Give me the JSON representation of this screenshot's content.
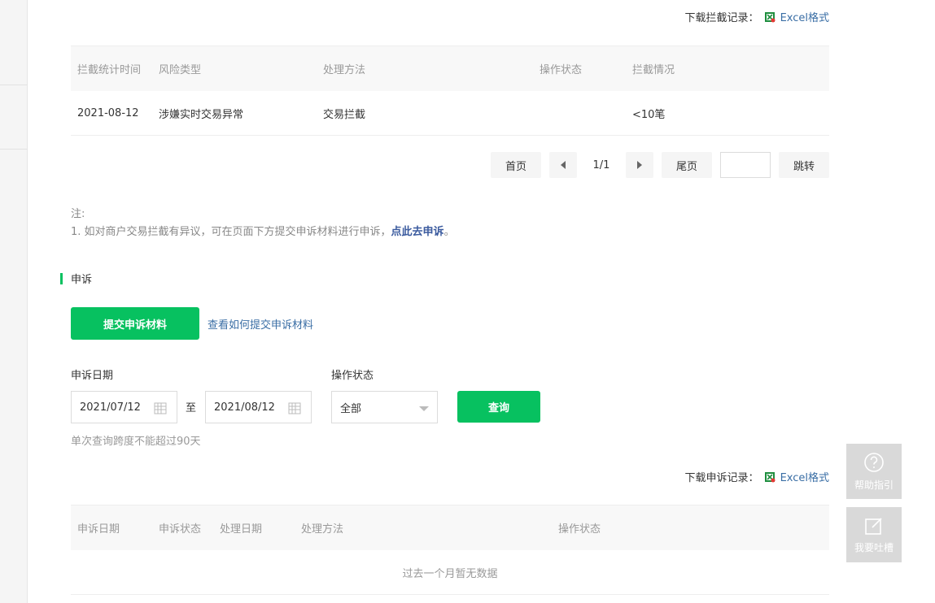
{
  "block_download": {
    "label": "下载拦截记录：",
    "link": "Excel格式"
  },
  "block_table": {
    "headers": [
      "拦截统计时间",
      "风险类型",
      "处理方法",
      "操作状态",
      "拦截情况"
    ],
    "rows": [
      {
        "date": "2021-08-12",
        "risk": "涉嫌实时交易异常",
        "method": "交易拦截",
        "status": "",
        "situation": "<10笔"
      }
    ]
  },
  "pager": {
    "first": "首页",
    "info": "1/1",
    "last": "尾页",
    "jump": "跳转"
  },
  "note": {
    "title": "注:",
    "line1_prefix": "1.  如对商户交易拦截有异议，可在页面下方提交申诉材料进行申诉，",
    "line1_link": "点此去申诉",
    "line1_suffix": "。"
  },
  "appeal": {
    "title": "申诉",
    "submit_button": "提交申诉材料",
    "how_link": "查看如何提交申诉材料",
    "date_label": "申诉日期",
    "start_date": "2021/07/12",
    "to": "至",
    "end_date": "2021/08/12",
    "status_label": "操作状态",
    "status_value": "全部",
    "query_button": "查询",
    "hint": "单次查询跨度不能超过90天"
  },
  "appeal_download": {
    "label": "下载申诉记录：",
    "link": "Excel格式"
  },
  "appeal_table": {
    "headers": [
      "申诉日期",
      "申诉状态",
      "处理日期",
      "处理方法",
      "操作状态"
    ],
    "empty": "过去一个月暂无数据"
  },
  "float": {
    "help": "帮助指引",
    "feedback": "我要吐槽"
  },
  "colors": {
    "accent": "#07c160",
    "link": "#3a6ea5"
  }
}
